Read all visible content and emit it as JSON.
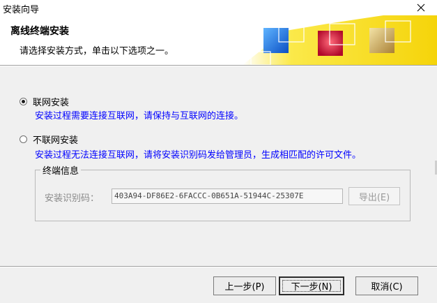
{
  "window": {
    "title": "安装向导",
    "close_symbol": "✕"
  },
  "header": {
    "title": "离线终端安装",
    "subtitle": "请选择安装方式，单击以下选项之一。",
    "banner_colors": [
      "#f7d90a",
      "#1d6fd6",
      "#d11235",
      "#c7a55a"
    ]
  },
  "options": [
    {
      "label": "联网安装",
      "checked": true,
      "description": "安装过程需要连接互联网，请保持与互联网的连接。"
    },
    {
      "label": "不联网安装",
      "checked": false,
      "description": "安装过程无法连接互联网，请将安装识别码发给管理员，生成相匹配的许可文件。"
    }
  ],
  "terminal_info": {
    "legend": "终端信息",
    "code_label": "安装识别码：",
    "code_value": "403A94-DF86E2-6FACCC-0B651A-51944C-25307E",
    "export_label": "导出(E)"
  },
  "buttons": {
    "back": "上一步(P)",
    "next": "下一步(N)",
    "cancel": "取消(C)"
  },
  "icons": {
    "close": "close-icon",
    "radio": "radio-icon"
  }
}
